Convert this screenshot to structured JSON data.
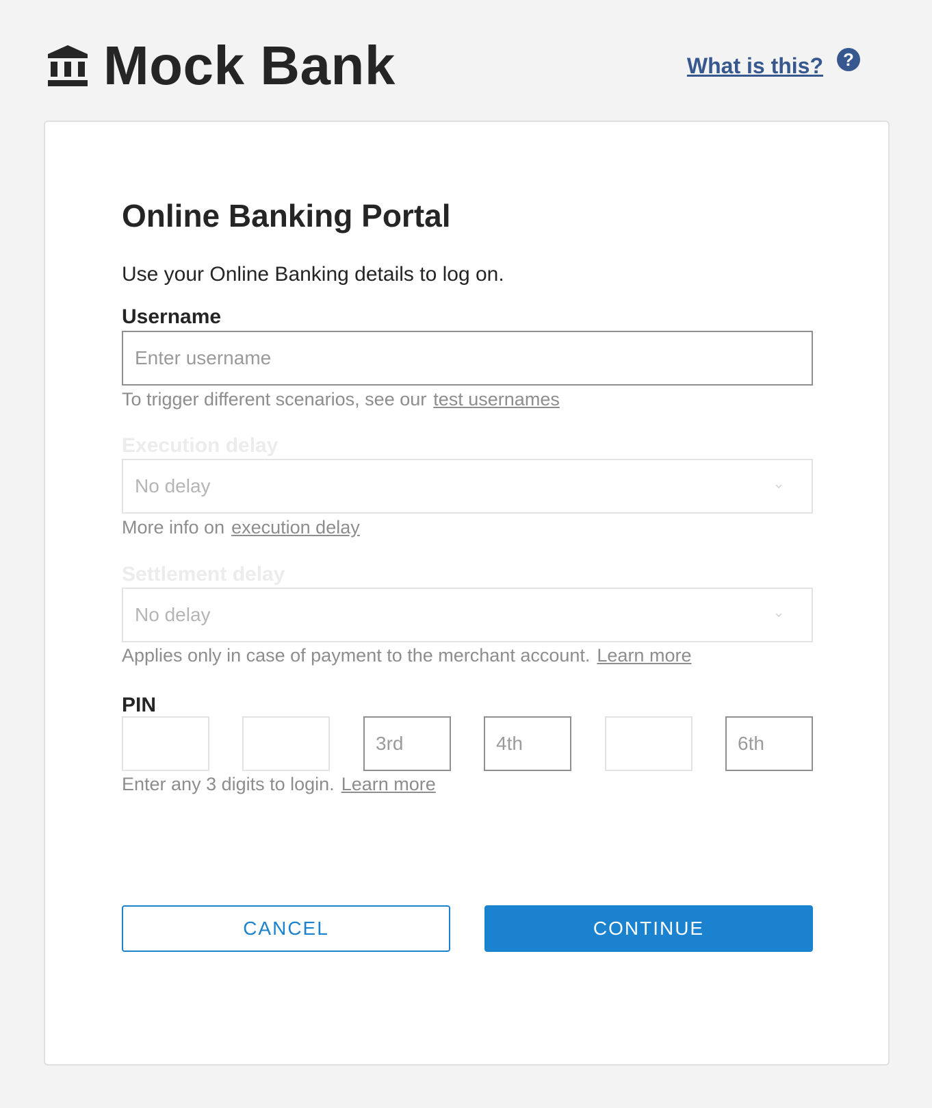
{
  "header": {
    "brand": "Mock Bank",
    "help_link": "What is this?",
    "help_icon_glyph": "?",
    "brand_icon": "bank-icon"
  },
  "form": {
    "title": "Online Banking Portal",
    "subtitle": "Use your Online Banking details to log on.",
    "username": {
      "label": "Username",
      "placeholder": "Enter username",
      "value": "",
      "hint": "To trigger different scenarios, see our",
      "hint_link": "test usernames"
    },
    "execution_delay": {
      "label": "Execution delay",
      "value": "No delay",
      "hint": "More info on",
      "hint_link": "execution delay"
    },
    "settlement_delay": {
      "label": "Settlement delay",
      "value": "No delay",
      "hint": "Applies only in case of payment to the merchant account.",
      "hint_link": "Learn more"
    },
    "pin": {
      "label": "PIN",
      "boxes": [
        {
          "placeholder": "",
          "enabled": false
        },
        {
          "placeholder": "",
          "enabled": false
        },
        {
          "placeholder": "3rd",
          "enabled": true
        },
        {
          "placeholder": "4th",
          "enabled": true
        },
        {
          "placeholder": "",
          "enabled": false
        },
        {
          "placeholder": "6th",
          "enabled": true
        }
      ],
      "hint": "Enter any 3 digits to login.",
      "hint_link": "Learn more"
    },
    "cancel_label": "CANCEL",
    "continue_label": "CONTINUE"
  },
  "colors": {
    "background": "#f3f3f3",
    "brand_text": "#252525",
    "link_blue": "#36588f",
    "primary": "#1b82cf",
    "disabled_label": "#ececec",
    "hint_text": "#8d8d8d"
  }
}
